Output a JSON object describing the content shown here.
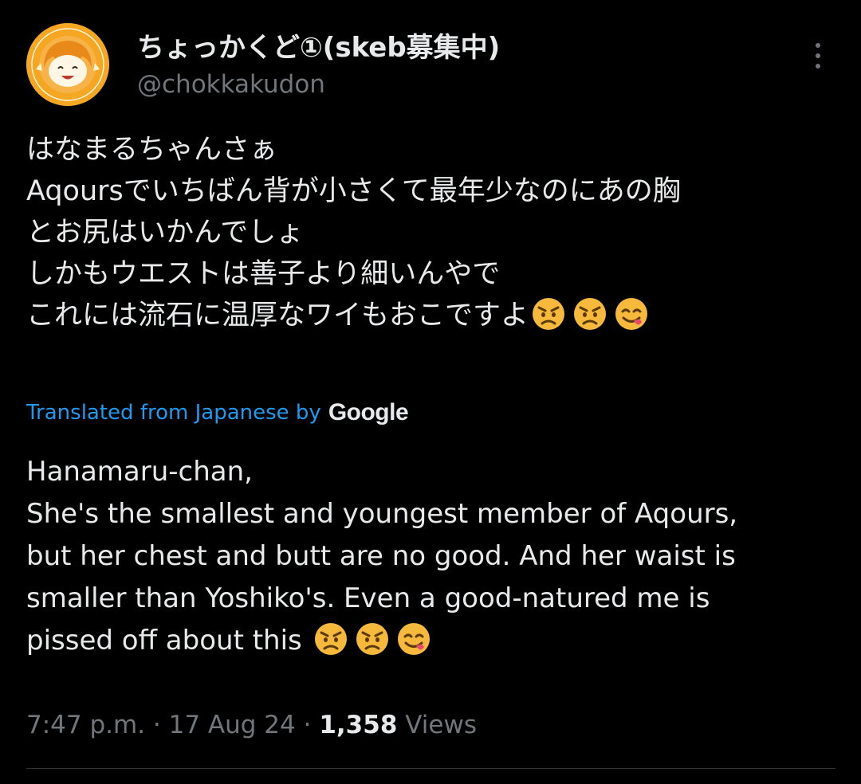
{
  "author": {
    "display_name": "ちょっかくど①(skeb募集中)",
    "handle": "@chokkakudon"
  },
  "menu": {
    "icon": "more-vertical-icon"
  },
  "tweet": {
    "original_lines": [
      "はなまるちゃんさぁ",
      "Aqoursでいちばん背が小さくて最年少なのにあの胸",
      "とお尻はいかんでしょ",
      "しかもウエストは善子より細いんやで",
      "これには流石に温厚なワイもおこですよ"
    ],
    "emojis": [
      "angry-face-icon",
      "angry-face-icon",
      "face-savoring-food-icon"
    ],
    "translation_label": "Translated from Japanese by",
    "translation_provider": "Google",
    "translated_lines": [
      "Hanamaru-chan,",
      "She's the smallest and youngest member of Aqours,",
      "but her chest and butt are no good. And her waist is",
      "smaller than Yoshiko's. Even a good-natured me is",
      "pissed off about this"
    ]
  },
  "meta": {
    "time": "7:47 p.m.",
    "separator": " · ",
    "date": "17 Aug 24",
    "views_count": "1,358",
    "views_label": "Views"
  },
  "colors": {
    "background": "#000000",
    "text_primary": "#e7e9ea",
    "text_secondary": "#71767b",
    "link": "#1d9bf0",
    "divider": "#2f3336",
    "avatar_orange": "#f5a623"
  }
}
